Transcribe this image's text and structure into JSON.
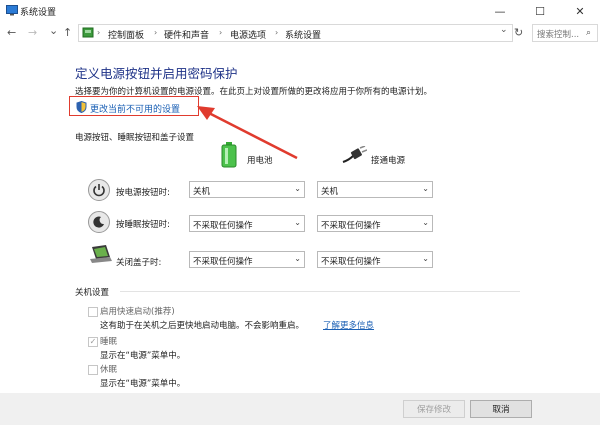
{
  "window": {
    "title": "系统设置",
    "minimize": "—",
    "maximize": "☐",
    "close": "✕"
  },
  "nav": {
    "back": "←",
    "forward": "→",
    "recent": "⌄",
    "up": "↑",
    "breadcrumbs": [
      "控制面板",
      "硬件和声音",
      "电源选项",
      "系统设置"
    ],
    "refresh": "↻",
    "search_placeholder": "搜索控制..."
  },
  "main": {
    "title": "定义电源按钮并启用密码保护",
    "description": "选择要为你的计算机设置的电源设置。在此页上对设置所做的更改将应用于你所有的电源计划。",
    "change_link": "更改当前不可用的设置",
    "section_buttons": "电源按钮、睡眠按钮和盖子设置",
    "col_battery": "用电池",
    "col_plugged": "接通电源",
    "rows": [
      {
        "label": "按电源按钮时:",
        "battery": "关机",
        "plugged": "关机"
      },
      {
        "label": "按睡眠按钮时:",
        "battery": "不采取任何操作",
        "plugged": "不采取任何操作"
      },
      {
        "label": "关闭盖子时:",
        "battery": "不采取任何操作",
        "plugged": "不采取任何操作"
      }
    ],
    "section_shutdown": "关机设置",
    "shutdown_options": [
      {
        "label": "启用快速启动(推荐)",
        "checked": false,
        "desc": "这有助于在关机之后更快地启动电脑。不会影响重启。",
        "link": "了解更多信息"
      },
      {
        "label": "睡眠",
        "checked": true,
        "desc": "显示在“电源”菜单中。",
        "link": ""
      },
      {
        "label": "休眠",
        "checked": false,
        "desc": "显示在“电源”菜单中。",
        "link": ""
      }
    ]
  },
  "footer": {
    "save": "保存修改",
    "cancel": "取消"
  },
  "colors": {
    "title": "#1e3287",
    "link": "#1a5fb4",
    "highlight": "#e03b2e"
  }
}
